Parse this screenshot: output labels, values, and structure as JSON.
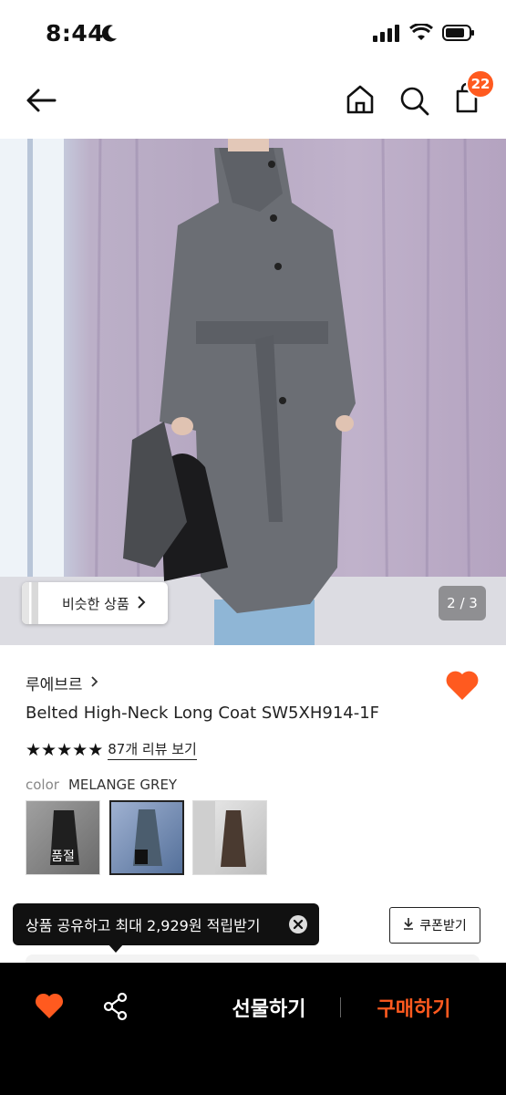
{
  "status": {
    "time": "8:44"
  },
  "header": {
    "cart_count": "22"
  },
  "hero": {
    "similar_label": "비슷한 상품",
    "pager": "2 / 3"
  },
  "product": {
    "brand": "루에브르",
    "title": "Belted High-Neck Long Coat SW5XH914-1F",
    "rating_stars": 5,
    "reviews_link": "87개 리뷰 보기",
    "color_label": "color",
    "color_value": "MELANGE GREY",
    "swatches": [
      {
        "badge": "품절"
      },
      {
        "badge": ""
      },
      {
        "badge": ""
      }
    ]
  },
  "promo": {
    "tooltip": "상품 공유하고 최대 2,929원 적립받기",
    "coupon": "쿠폰받기"
  },
  "bottom": {
    "gift": "선물하기",
    "buy": "구매하기"
  },
  "colors": {
    "accent": "#ff5a1f",
    "bar": "#000000"
  }
}
